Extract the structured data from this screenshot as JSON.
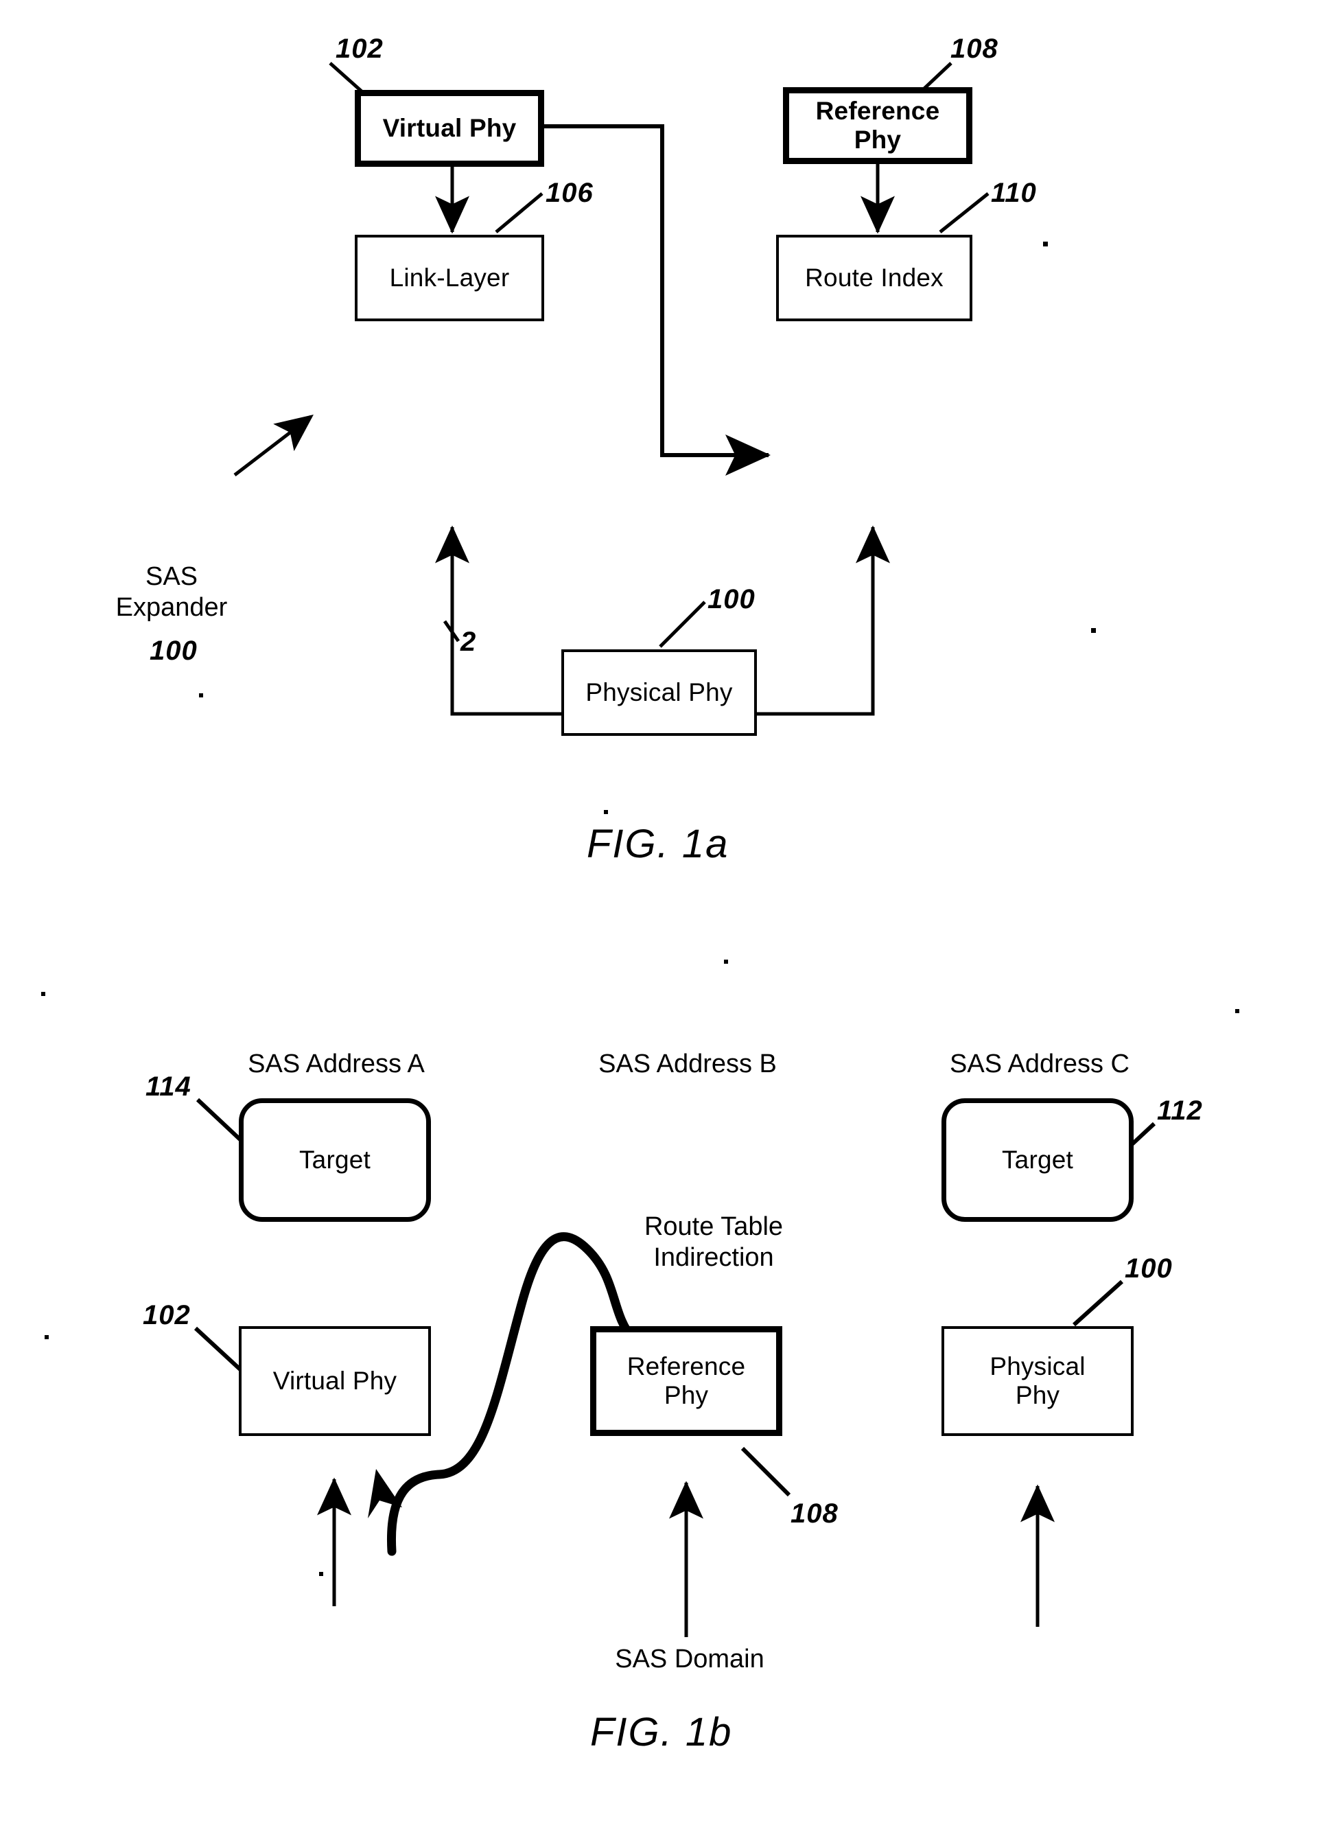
{
  "figures": [
    {
      "id": "fig1a",
      "caption": "FIG. 1a",
      "annotation": {
        "name": "SAS\nExpander",
        "ref": "100"
      },
      "edge_label": "2",
      "nodes": [
        {
          "key": "virtual_phy",
          "label": "Virtual Phy",
          "ref": "102",
          "style": "bold-border"
        },
        {
          "key": "reference_phy",
          "label": "Reference\nPhy",
          "ref": "108",
          "style": "bold-border"
        },
        {
          "key": "link_layer",
          "label": "Link-Layer",
          "ref": "106",
          "style": "thin-border"
        },
        {
          "key": "route_index",
          "label": "Route Index",
          "ref": "110",
          "style": "thin-border"
        },
        {
          "key": "physical_phy",
          "label": "Physical Phy",
          "ref": "100",
          "style": "thin-border"
        }
      ],
      "connections": [
        {
          "from": "virtual_phy",
          "to": "link_layer",
          "kind": "arrow"
        },
        {
          "from": "virtual_phy",
          "to": "route_index",
          "kind": "arrow"
        },
        {
          "from": "reference_phy",
          "to": "route_index",
          "kind": "arrow"
        },
        {
          "from": "physical_phy",
          "to": "link_layer",
          "kind": "arrow"
        },
        {
          "from": "physical_phy",
          "to": "route_index",
          "kind": "arrow"
        }
      ]
    },
    {
      "id": "fig1b",
      "caption": "FIG. 1b",
      "column_headers": [
        "SAS Address A",
        "SAS Address B",
        "SAS Address C"
      ],
      "curve_label": "Route Table\nIndirection",
      "bottom_label": "SAS Domain",
      "nodes": [
        {
          "key": "target_a",
          "label": "Target",
          "ref": "114",
          "shape": "rounded"
        },
        {
          "key": "target_c",
          "label": "Target",
          "ref": "112",
          "shape": "rounded"
        },
        {
          "key": "virtual_phy",
          "label": "Virtual Phy",
          "ref": "102",
          "shape": "rect"
        },
        {
          "key": "reference_phy",
          "label": "Reference\nPhy",
          "ref": "108",
          "shape": "rect-bold"
        },
        {
          "key": "physical_phy",
          "label": "Physical\nPhy",
          "ref": "100",
          "shape": "rect"
        }
      ]
    }
  ]
}
